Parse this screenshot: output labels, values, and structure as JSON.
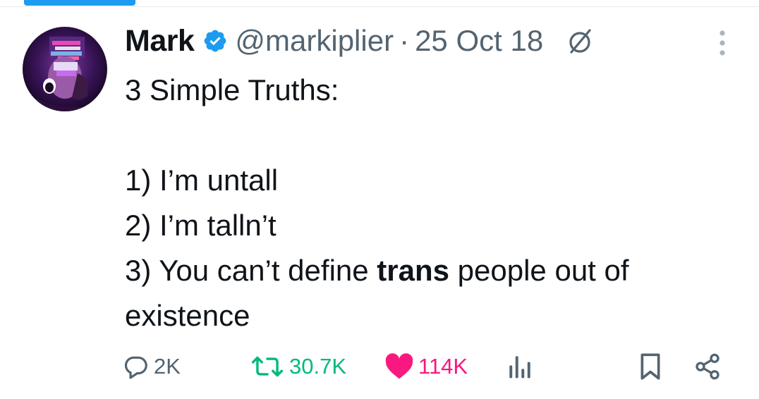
{
  "tweet": {
    "display_name": "Mark",
    "handle": "@markiplier",
    "separator": "·",
    "date": "25 Oct 18",
    "text_lines": {
      "l1": "3 Simple Truths:",
      "l3": "1) I’m untall",
      "l4": "2) I’m talln’t",
      "l5_pre": "3) You can’t define ",
      "l5_bold": "trans",
      "l5_post": " people out of",
      "l6": "existence"
    }
  },
  "icons": {
    "verified": "verified-badge-icon",
    "edit": "edited-icon",
    "more": "more-options-icon",
    "reply": "reply-icon",
    "retweet": "retweet-icon",
    "like": "like-heart-icon",
    "views": "views-chart-icon",
    "bookmark": "bookmark-icon",
    "share": "share-icon"
  },
  "actions": {
    "reply_count": "2K",
    "retweet_count": "30.7K",
    "like_count": "114K"
  },
  "colors": {
    "accent_blue": "#1d9bf0",
    "retweet_green": "#00ba7c",
    "like_pink": "#f91880",
    "muted": "#536471",
    "text": "#0f1419"
  }
}
